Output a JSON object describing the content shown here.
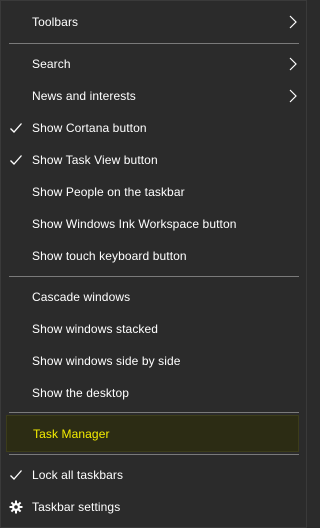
{
  "menu": {
    "items": [
      {
        "label": "Toolbars",
        "submenu": true,
        "checked": false
      },
      {
        "label": "Search",
        "submenu": true,
        "checked": false
      },
      {
        "label": "News and interests",
        "submenu": true,
        "checked": false
      },
      {
        "label": "Show Cortana button",
        "submenu": false,
        "checked": true
      },
      {
        "label": "Show Task View button",
        "submenu": false,
        "checked": true
      },
      {
        "label": "Show People on the taskbar",
        "submenu": false,
        "checked": false
      },
      {
        "label": "Show Windows Ink Workspace button",
        "submenu": false,
        "checked": false
      },
      {
        "label": "Show touch keyboard button",
        "submenu": false,
        "checked": false
      },
      {
        "label": "Cascade windows",
        "submenu": false,
        "checked": false
      },
      {
        "label": "Show windows stacked",
        "submenu": false,
        "checked": false
      },
      {
        "label": "Show windows side by side",
        "submenu": false,
        "checked": false
      },
      {
        "label": "Show the desktop",
        "submenu": false,
        "checked": false
      },
      {
        "label": "Task Manager",
        "submenu": false,
        "checked": false,
        "highlighted": true
      },
      {
        "label": "Lock all taskbars",
        "submenu": false,
        "checked": true
      },
      {
        "label": "Taskbar settings",
        "submenu": false,
        "checked": false,
        "icon": "gear-icon"
      }
    ]
  },
  "colors": {
    "background": "#2b2b2b",
    "text": "#ffffff",
    "separator": "#7a7a7a",
    "highlight_text": "#f5ee00",
    "highlight_background": "#2c2c14"
  }
}
